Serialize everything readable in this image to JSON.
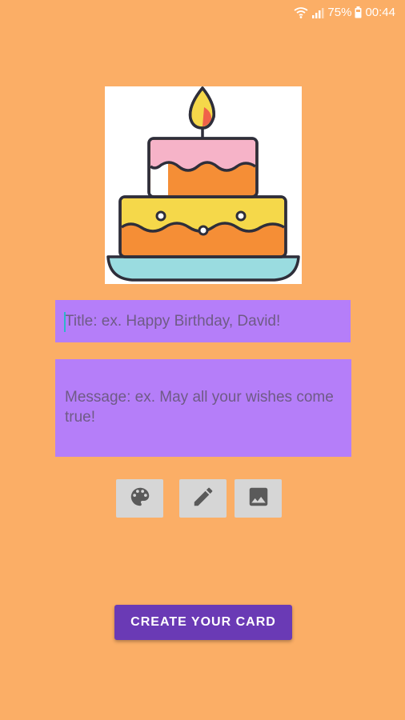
{
  "status_bar": {
    "battery_percent": "75%",
    "time": "00:44",
    "icons": [
      "wifi-icon",
      "signal-icon",
      "battery-icon"
    ]
  },
  "cake_image": {
    "icon": "birthday-cake-illustration"
  },
  "form": {
    "title_placeholder": "Title: ex. Happy Birthday, David!",
    "message_placeholder": "Message: ex. May all your wishes come true!"
  },
  "toolbar": {
    "buttons": [
      {
        "icon": "palette-icon"
      },
      {
        "icon": "pencil-icon"
      },
      {
        "icon": "image-icon"
      }
    ]
  },
  "actions": {
    "create_label": "CREATE YOUR CARD"
  },
  "colors": {
    "background": "#FBAE66",
    "field": "#B57EF9",
    "primary_button": "#6A3AB5",
    "tool_button": "#D6D6D6"
  }
}
